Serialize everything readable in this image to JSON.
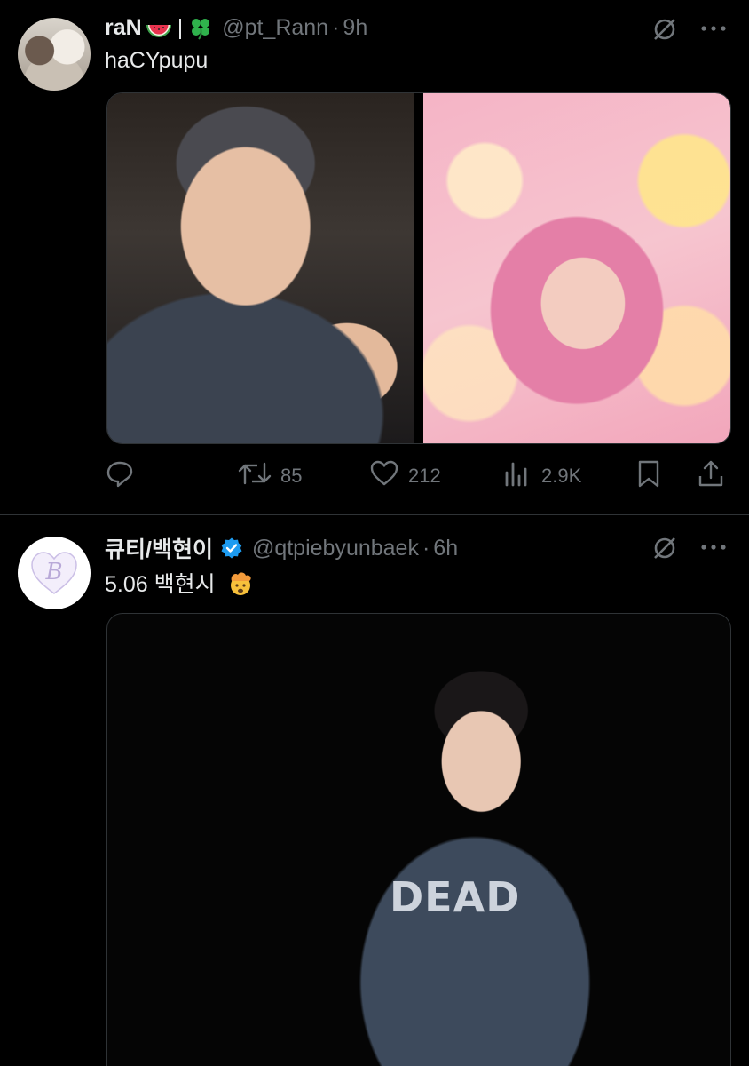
{
  "tweets": [
    {
      "display_name": "raN",
      "name_separator": "|",
      "handle": "@pt_Rann",
      "dot": "·",
      "time": "9h",
      "text": "haCYpupu",
      "stats": {
        "retweets": "85",
        "likes": "212",
        "views": "2.9K"
      }
    },
    {
      "display_name": "큐티/백현이",
      "handle": "@qtpiebyunbaek",
      "dot": "·",
      "time": "6h",
      "text": "5.06 백현시",
      "avatar_letter": "B",
      "shirt_print": "DEAD"
    }
  ],
  "colors": {
    "background": "#000000",
    "text_primary": "#e7e9ea",
    "text_secondary": "#71767b",
    "verified": "#1d9bf0",
    "divider": "#2f3336"
  },
  "icons": [
    "grok-icon",
    "more-icon",
    "reply-icon",
    "retweet-icon",
    "like-icon",
    "views-icon",
    "bookmark-icon",
    "share-icon",
    "verified-icon",
    "watermelon-emoji",
    "clover-emoji",
    "exploding-head-emoji"
  ]
}
